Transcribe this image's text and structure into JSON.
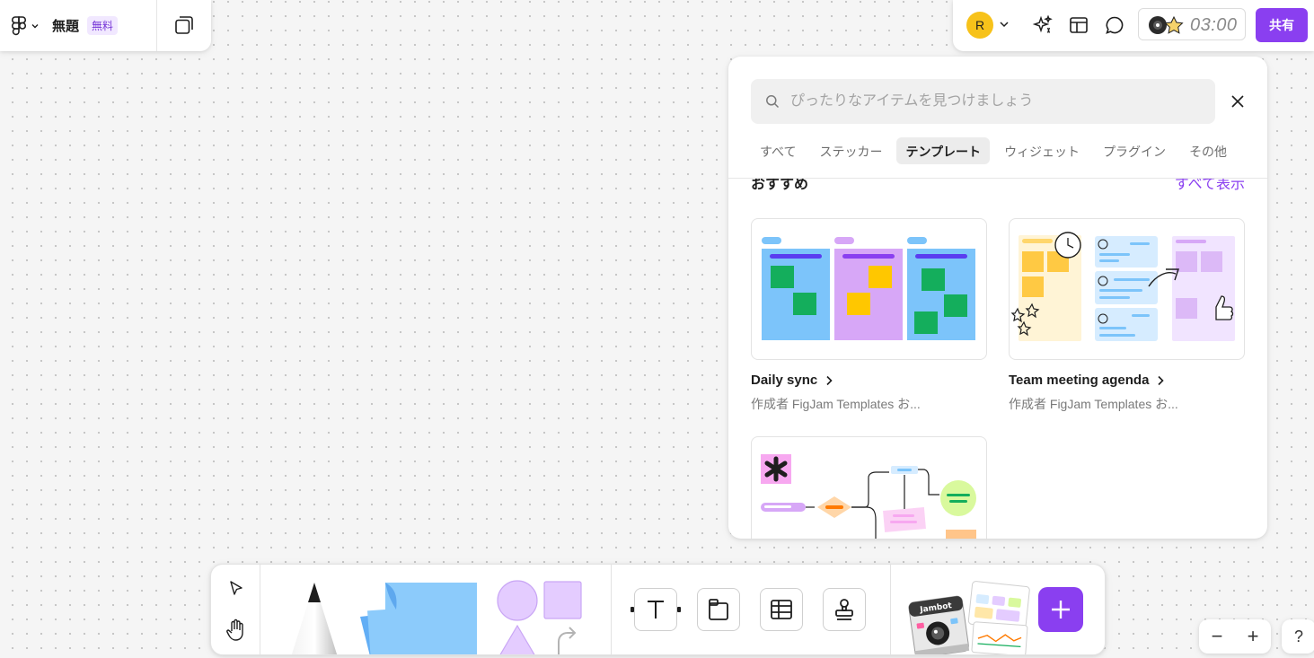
{
  "file": {
    "title": "無題",
    "plan_badge": "無料"
  },
  "header": {
    "avatar_initial": "R",
    "timer": "03:00",
    "share_label": "共有",
    "accent": "#8a3ff0"
  },
  "resources": {
    "search_placeholder": "ぴったりなアイテムを見つけましょう",
    "tabs": [
      {
        "label": "すべて"
      },
      {
        "label": "ステッカー"
      },
      {
        "label": "テンプレート",
        "active": true
      },
      {
        "label": "ウィジェット"
      },
      {
        "label": "プラグイン"
      },
      {
        "label": "その他"
      }
    ],
    "section_title": "おすすめ",
    "see_all": "すべて表示",
    "cards": [
      {
        "title": "Daily sync",
        "subtitle": "作成者 FigJam Templates お..."
      },
      {
        "title": "Team meeting agenda",
        "subtitle": "作成者 FigJam Templates お..."
      }
    ]
  },
  "zoom": {
    "minus": "−",
    "plus": "+"
  },
  "help": "?"
}
